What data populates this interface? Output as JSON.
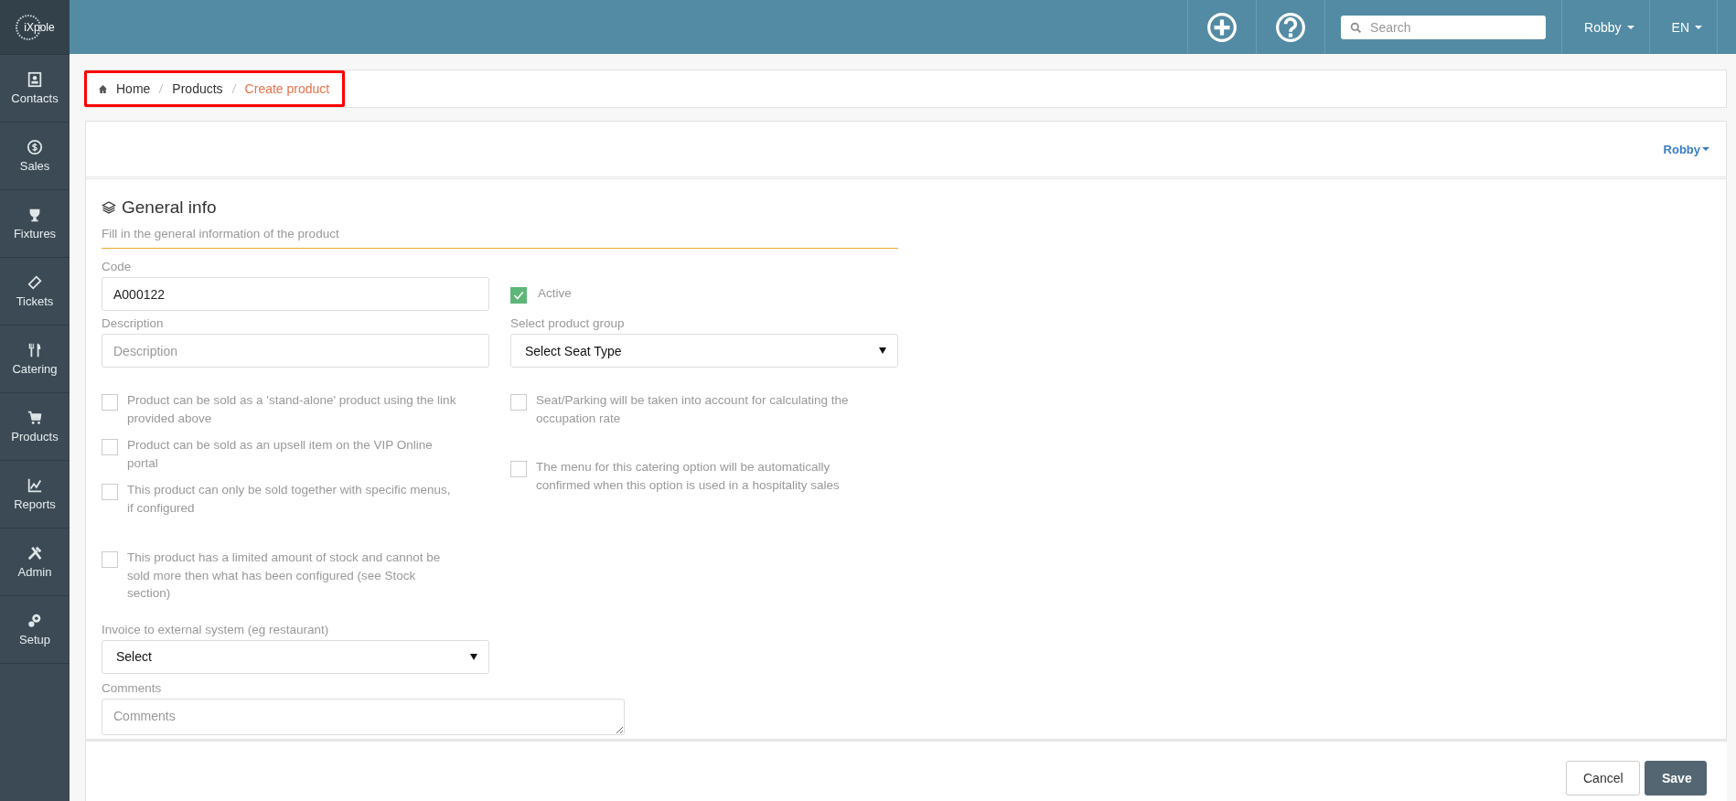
{
  "brand": "iXpole",
  "topbar": {
    "search": {
      "placeholder": "Search"
    },
    "user": "Robby",
    "language": "EN"
  },
  "sidebar": {
    "items": [
      {
        "label": "Contacts"
      },
      {
        "label": "Sales"
      },
      {
        "label": "Fixtures"
      },
      {
        "label": "Tickets"
      },
      {
        "label": "Catering"
      },
      {
        "label": "Products"
      },
      {
        "label": "Reports"
      },
      {
        "label": "Admin"
      },
      {
        "label": "Setup"
      }
    ]
  },
  "breadcrumb": [
    {
      "label": "Home"
    },
    {
      "label": "Products"
    },
    {
      "label": "Create product"
    }
  ],
  "card": {
    "owner": "Robby",
    "section": {
      "title": "General info",
      "subtitle": "Fill in the general information of the product"
    }
  },
  "form": {
    "code": {
      "label": "Code",
      "value": "A000122"
    },
    "active": {
      "label": "Active",
      "checked": true
    },
    "description": {
      "label": "Description",
      "placeholder": "Description"
    },
    "product_group": {
      "label": "Select product group",
      "value": "Select Seat Type"
    },
    "options_left": [
      {
        "label": "Product can be sold as a 'stand-alone' product using the link provided above",
        "checked": false
      },
      {
        "label": "Product can be sold as an upsell item on the VIP Online portal",
        "checked": false
      },
      {
        "label": "This product can only be sold together with specific menus, if configured",
        "checked": false
      },
      {
        "label": "This product has a limited amount of stock and cannot be sold more then what has been configured (see Stock section)",
        "checked": false
      }
    ],
    "options_right": [
      {
        "label": "Seat/Parking will be taken into account for calculating the occupation rate",
        "checked": false
      },
      {
        "label": "The menu for this catering option will be automatically confirmed when this option is used in a hospitality sales",
        "checked": false
      }
    ],
    "invoice": {
      "label": "Invoice to external system (eg restaurant)",
      "value": "Select"
    },
    "comments": {
      "label": "Comments",
      "placeholder": "Comments"
    }
  },
  "footer": {
    "buttons": [
      {
        "label": "Cancel",
        "kind": "secondary"
      },
      {
        "label": "Save",
        "kind": "primary"
      }
    ]
  }
}
